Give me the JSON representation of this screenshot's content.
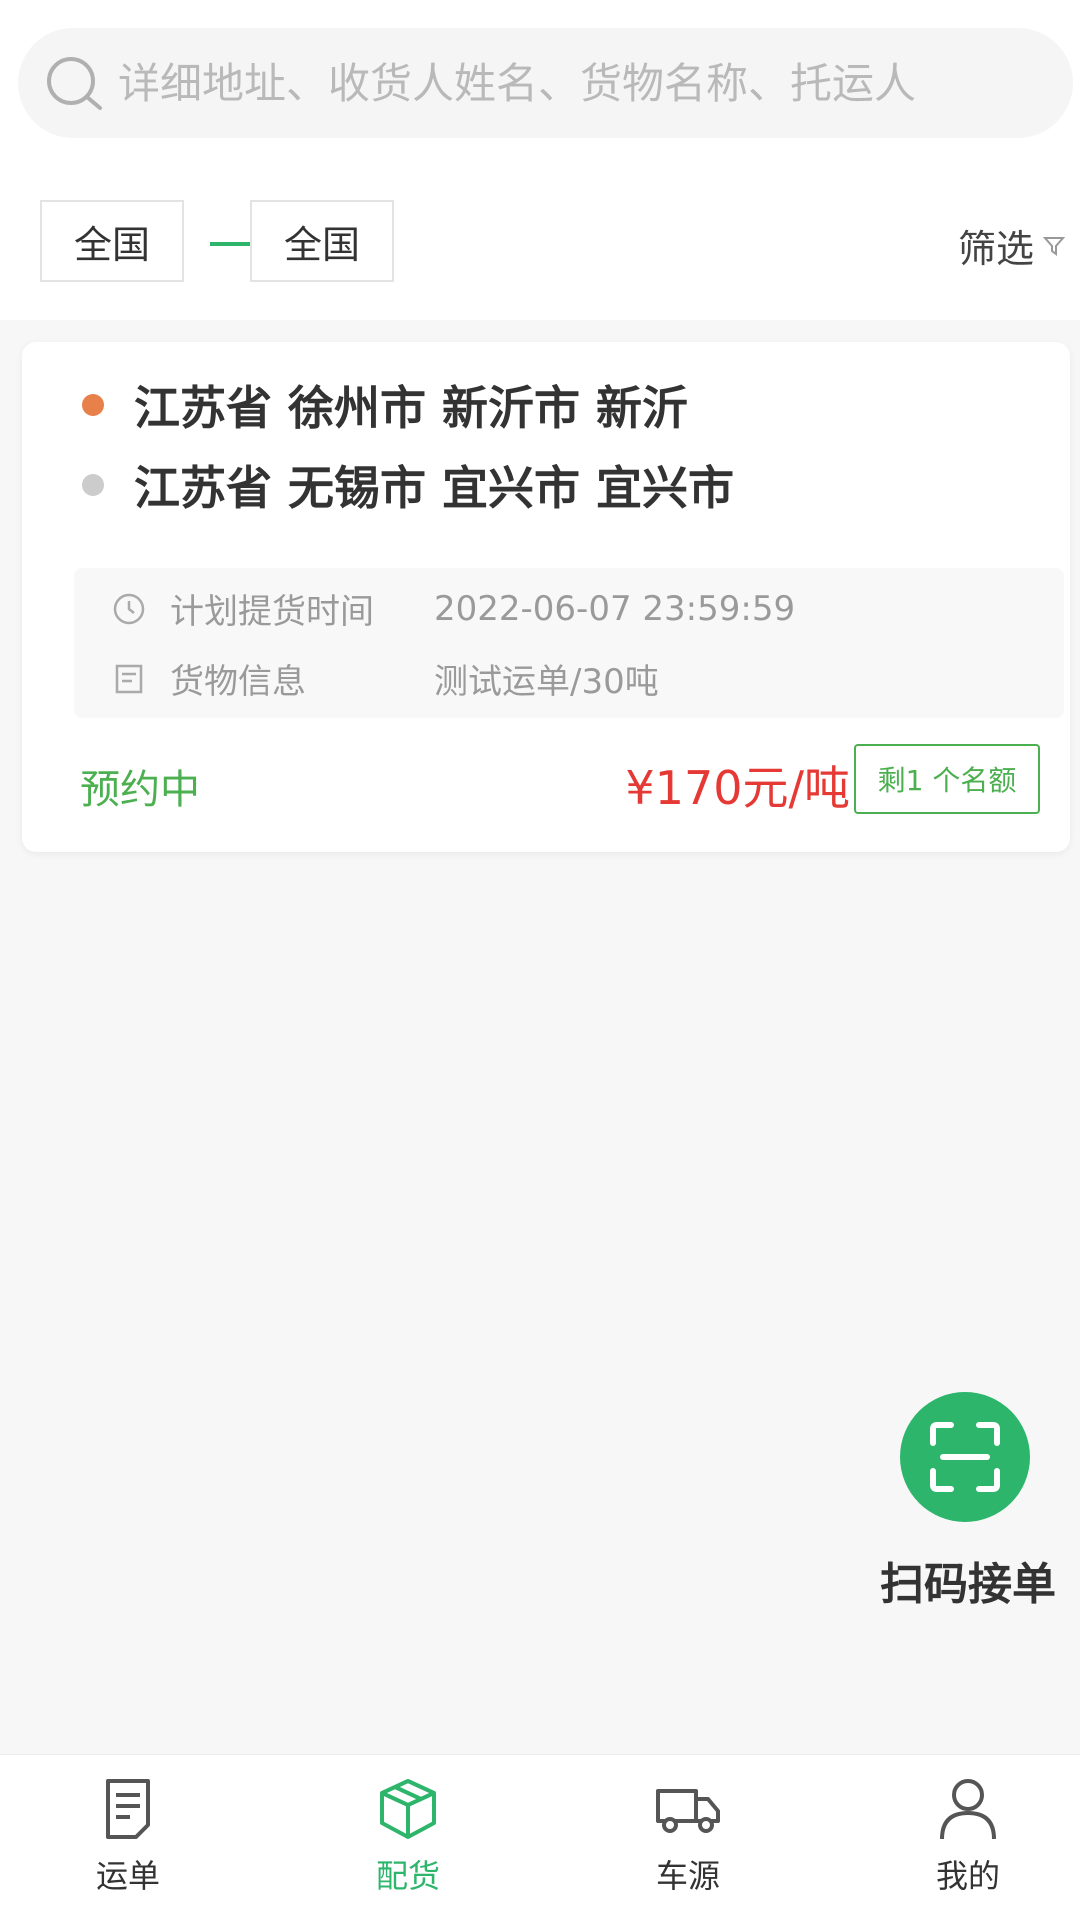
{
  "search": {
    "placeholder": "详细地址、收货人姓名、货物名称、托运人"
  },
  "region": {
    "from": "全国",
    "to": "全国",
    "filter_label": "筛选"
  },
  "order": {
    "origin": "江苏省 徐州市 新沂市 新沂",
    "destination": "江苏省 无锡市 宜兴市 宜兴市",
    "pickup_label": "计划提货时间",
    "pickup_time": "2022-06-07 23:59:59",
    "cargo_label": "货物信息",
    "cargo_info": "测试运单/30吨",
    "status": "预约中",
    "price": "¥170元/吨",
    "quota": "剩1 个名额"
  },
  "scan": {
    "label": "扫码接单"
  },
  "tabs": [
    {
      "label": "运单",
      "icon": "waybill-icon"
    },
    {
      "label": "配货",
      "icon": "box-icon"
    },
    {
      "label": "车源",
      "icon": "truck-icon"
    },
    {
      "label": "我的",
      "icon": "user-icon"
    }
  ],
  "colors": {
    "accent": "#2db56b",
    "price": "#e53935",
    "origin_dot": "#e8804a",
    "dest_dot": "#cccccc"
  }
}
